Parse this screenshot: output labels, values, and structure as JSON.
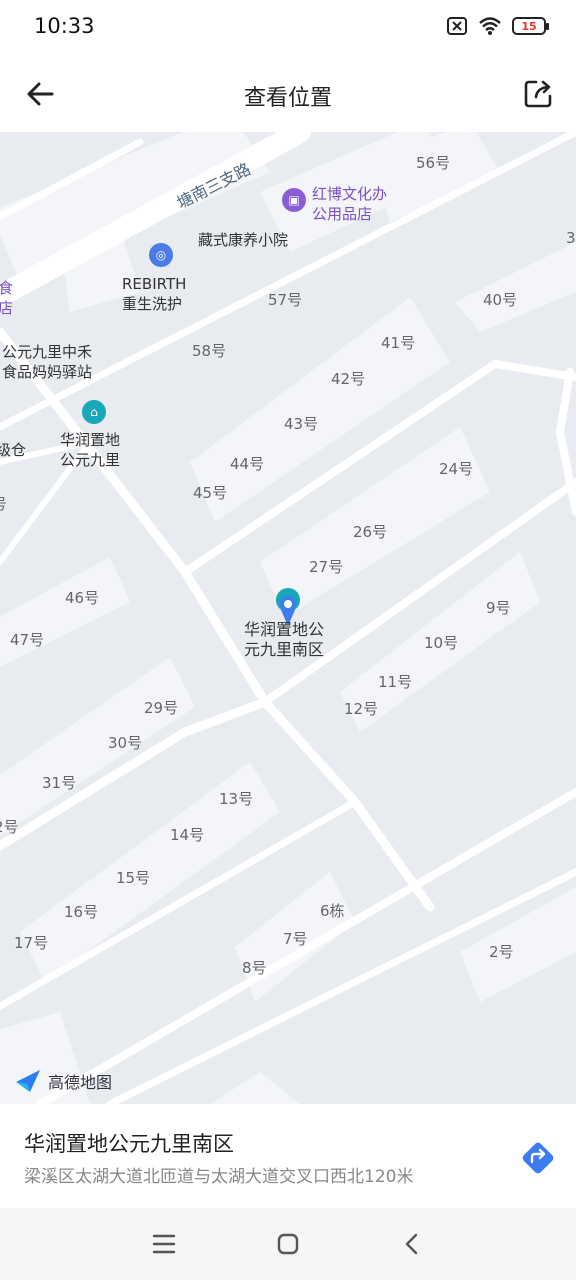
{
  "status": {
    "time": "10:33",
    "battery": "15"
  },
  "header": {
    "title": "查看位置"
  },
  "map": {
    "road_label": "塘南三支路",
    "pois": {
      "hongbo": "红博文化办\n公用品店",
      "zangshi": "藏式康养小院",
      "rebirth": "REBIRTH\n重生洗护",
      "station": "公元九里中禾\n食品妈妈驿站",
      "huarun": "华润置地\n公元九里",
      "selected": "华润置地公\n元九里南区",
      "edge_shi": "食",
      "edge_dian": "店",
      "edge_cang": "级仓"
    },
    "buildings": {
      "b56": "56号",
      "b57": "57号",
      "b58": "58号",
      "b40": "40号",
      "b41": "41号",
      "b42": "42号",
      "b43": "43号",
      "b44": "44号",
      "b45": "45号",
      "b24": "24号",
      "b26": "26号",
      "b27": "27号",
      "b46": "46号",
      "b47": "47号",
      "b9": "9号",
      "b10": "10号",
      "b11": "11号",
      "b12": "12号",
      "b29": "29号",
      "b30": "30号",
      "b31": "31号",
      "b13": "13号",
      "b14": "14号",
      "b15": "15号",
      "b16": "16号",
      "b17": "17号",
      "b6": "6栋",
      "b7": "7号",
      "b8": "8号",
      "b2": "2号",
      "edge3": "3",
      "edge5": "号",
      "edge2": "2号"
    },
    "attribution": "高德地图"
  },
  "place": {
    "name": "华润置地公元九里南区",
    "address": "梁溪区太湖大道北匝道与太湖大道交叉口西北120米"
  },
  "colors": {
    "poi_teal": "#18a8b8",
    "poi_purple": "#8a5cd6",
    "poi_blue": "#4b7be5",
    "marker": "#3d7cf0"
  }
}
